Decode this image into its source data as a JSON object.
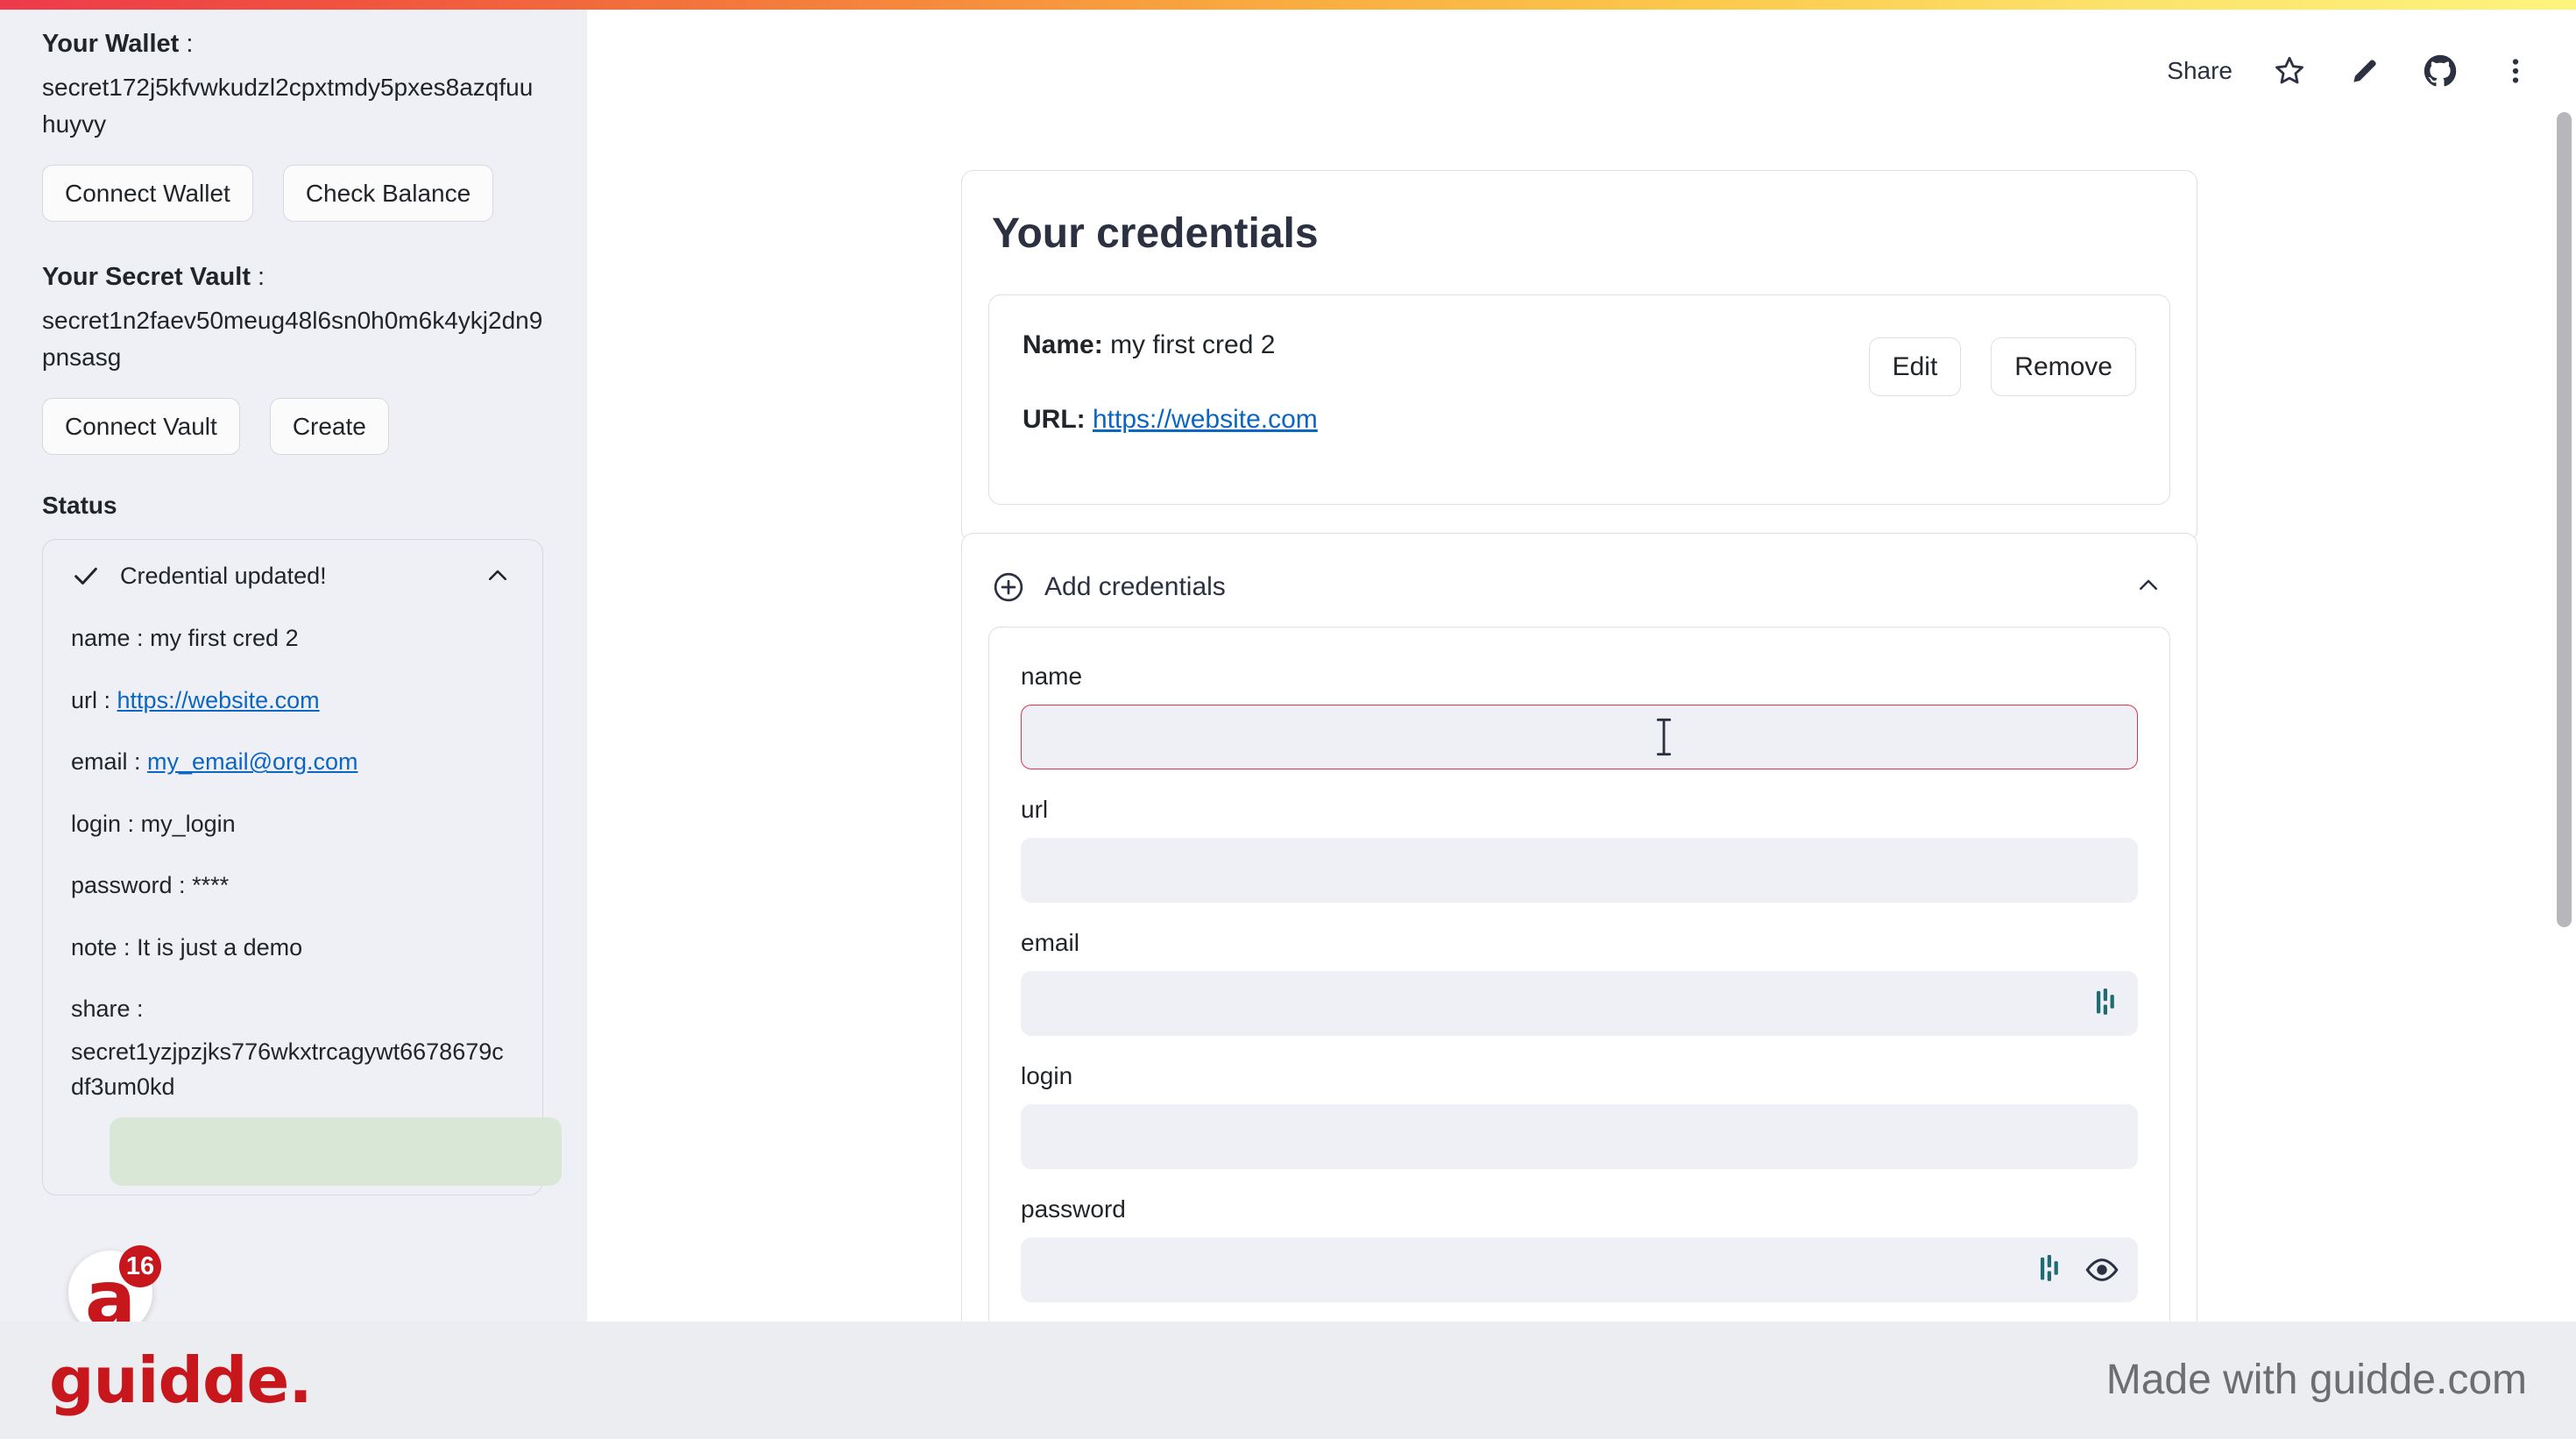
{
  "topbar": {
    "gradient_start": "#EE3A4C",
    "gradient_end": "#FDF47E"
  },
  "sidebar": {
    "wallet_heading": "Your Wallet",
    "wallet_address": "secret172j5kfvwkudzl2cpxtmdy5pxes8azqfuuhuyvy",
    "wallet_buttons": [
      {
        "label": "Connect Wallet"
      },
      {
        "label": "Check Balance"
      }
    ],
    "vault_heading": "Your Secret Vault",
    "vault_address": "secret1n2faev50meug48l6sn0h0m6k4ykj2dn9pnsasg",
    "vault_buttons": [
      {
        "label": "Connect Vault"
      },
      {
        "label": "Create"
      }
    ],
    "status_heading": "Status",
    "status_card": {
      "title": "Credential updated!",
      "check_icon": "check-icon",
      "collapse_icon": "chevron-up-icon",
      "lines": [
        {
          "label": "name :",
          "value": "my first cred 2",
          "link": false
        },
        {
          "label": "url :",
          "value": "https://website.com",
          "link": true
        },
        {
          "label": "email :",
          "value": "my_email@org.com",
          "link": true
        },
        {
          "label": "login :",
          "value": "my_login",
          "link": false
        },
        {
          "label": "password :",
          "value": "****",
          "link": false
        },
        {
          "label": "note :",
          "value": "It is just a demo",
          "link": false
        }
      ],
      "share_label": "share :",
      "share_value": "secret1yzjpzjks776wkxtrcagywt6678679cdf3um0kd"
    },
    "avatar": {
      "letter": "a",
      "badge_count": "16",
      "badge_color": "#C8161D"
    }
  },
  "toolbar": {
    "share_label": "Share",
    "icons": [
      {
        "name": "star-icon"
      },
      {
        "name": "pencil-edit-icon"
      },
      {
        "name": "github-icon"
      },
      {
        "name": "more-vertical-icon"
      }
    ]
  },
  "credentials_card": {
    "title": "Your credentials",
    "item": {
      "name_label": "Name",
      "name_value": "my first cred 2",
      "url_label": "URL",
      "url_value": "https://website.com",
      "edit_label": "Edit",
      "remove_label": "Remove"
    }
  },
  "add_credentials": {
    "header_label": "Add credentials",
    "plus_icon": "plus-circle-icon",
    "collapse_icon": "chevron-up-icon",
    "fields": [
      {
        "label": "name",
        "value": "",
        "placeholder": "",
        "state": "error",
        "adornments": []
      },
      {
        "label": "url",
        "value": "",
        "placeholder": "",
        "state": "normal",
        "adornments": []
      },
      {
        "label": "email",
        "value": "",
        "placeholder": "",
        "state": "normal",
        "adornments": [
          "password-manager-icon"
        ]
      },
      {
        "label": "login",
        "value": "",
        "placeholder": "",
        "state": "normal",
        "adornments": []
      },
      {
        "label": "password",
        "value": "",
        "placeholder": "",
        "state": "normal",
        "adornments": [
          "password-manager-icon",
          "eye-reveal-icon"
        ]
      }
    ],
    "error_color": "#DC3545"
  },
  "footer": {
    "logo_text": "guidde.",
    "made_with": "Made with guidde.com",
    "logo_color": "#C8161D"
  }
}
